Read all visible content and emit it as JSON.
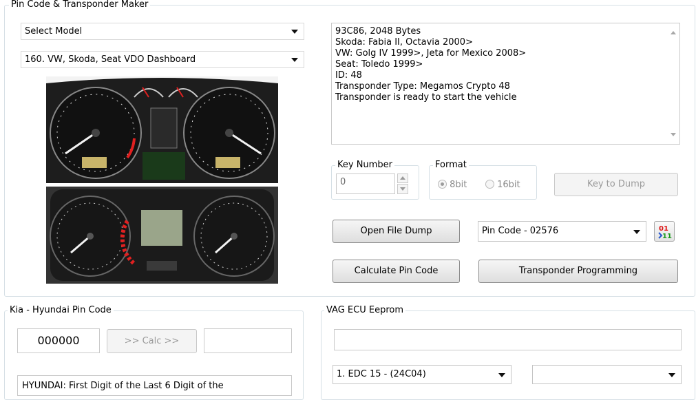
{
  "pin_maker": {
    "title": "Pin Code & Transponder Maker",
    "select_model": "Select Model",
    "dashboard_model": "160. VW, Skoda, Seat VDO Dashboard",
    "info_lines": [
      "93C86, 2048 Bytes",
      "Skoda: Fabia II, Octavia 2000>",
      "VW: Golg IV 1999>, Jeta for Mexico 2008>",
      "Seat: Toledo 1999>",
      "ID: 48",
      "Transponder Type: Megamos Crypto 48",
      "Transponder is ready to start the vehicle"
    ],
    "key_number_label": "Key Number",
    "key_number_value": "0",
    "format_label": "Format",
    "format_8bit": "8bit",
    "format_16bit": "16bit",
    "format_selected": "8bit",
    "key_to_dump": "Key to Dump",
    "open_file_dump": "Open File Dump",
    "pin_code_value": "Pin Code - 02576",
    "calculate_pin_code": "Calculate Pin Code",
    "transponder_programming": "Transponder Programming",
    "binary_icon_text_top": "01",
    "binary_icon_text_bottom": "11"
  },
  "kia_hyundai": {
    "title": "Kia - Hyundai Pin Code",
    "code_value": "000000",
    "calc_button": ">> Calc >>",
    "result_value": "",
    "note_text": "HYUNDAI: First Digit of the Last 6 Digit of the"
  },
  "vag_ecu": {
    "title": "VAG ECU Eeprom",
    "path_value": "",
    "ecu_model": "1. EDC 15 - (24C04)",
    "second_select": ""
  },
  "colors": {
    "group_border": "#d5dfe5",
    "button_gradient_top": "#f6f6f6",
    "button_gradient_bottom": "#dedede",
    "gauge_red": "#e02020"
  },
  "icons": {
    "combo_arrow": "chevron-down-icon",
    "binary_tool": "binary-convert-icon",
    "spin_up": "spin-up-icon",
    "spin_down": "spin-down-icon"
  }
}
